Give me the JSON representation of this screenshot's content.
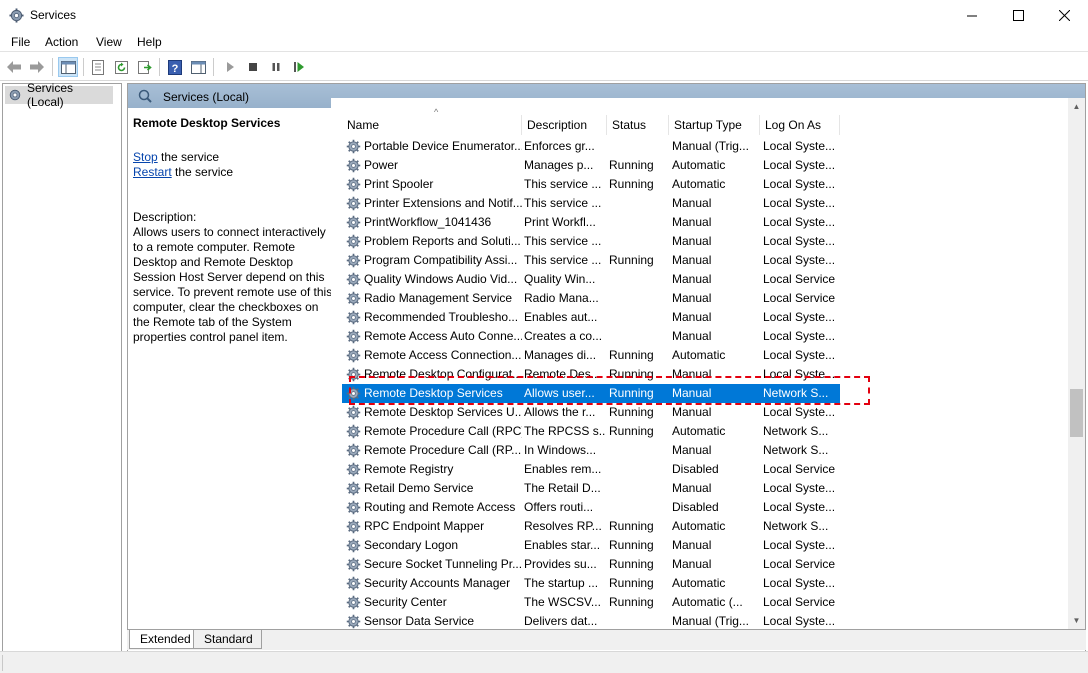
{
  "window": {
    "title": "Services"
  },
  "menu": [
    "File",
    "Action",
    "View",
    "Help"
  ],
  "tree": {
    "root_label": "Services (Local)"
  },
  "panel": {
    "header": "Services (Local)"
  },
  "details": {
    "service_title": "Remote Desktop Services",
    "stop_link": "Stop",
    "stop_suffix": " the service",
    "restart_link": "Restart",
    "restart_suffix": " the service",
    "description_label": "Description:",
    "description_text": "Allows users to connect interactively to a remote computer. Remote Desktop and Remote Desktop Session Host Server depend on this service. To prevent remote use of this computer, clear the checkboxes on the Remote tab of the System properties control panel item."
  },
  "columns": [
    "Name",
    "Description",
    "Status",
    "Startup Type",
    "Log On As"
  ],
  "services": [
    {
      "name": "Portable Device Enumerator...",
      "description": "Enforces gr...",
      "status": "",
      "startup": "Manual (Trig...",
      "logon": "Local Syste..."
    },
    {
      "name": "Power",
      "description": "Manages p...",
      "status": "Running",
      "startup": "Automatic",
      "logon": "Local Syste..."
    },
    {
      "name": "Print Spooler",
      "description": "This service ...",
      "status": "Running",
      "startup": "Automatic",
      "logon": "Local Syste..."
    },
    {
      "name": "Printer Extensions and Notif...",
      "description": "This service ...",
      "status": "",
      "startup": "Manual",
      "logon": "Local Syste..."
    },
    {
      "name": "PrintWorkflow_1041436",
      "description": "Print Workfl...",
      "status": "",
      "startup": "Manual",
      "logon": "Local Syste..."
    },
    {
      "name": "Problem Reports and Soluti...",
      "description": "This service ...",
      "status": "",
      "startup": "Manual",
      "logon": "Local Syste..."
    },
    {
      "name": "Program Compatibility Assi...",
      "description": "This service ...",
      "status": "Running",
      "startup": "Manual",
      "logon": "Local Syste..."
    },
    {
      "name": "Quality Windows Audio Vid...",
      "description": "Quality Win...",
      "status": "",
      "startup": "Manual",
      "logon": "Local Service"
    },
    {
      "name": "Radio Management Service",
      "description": "Radio Mana...",
      "status": "",
      "startup": "Manual",
      "logon": "Local Service"
    },
    {
      "name": "Recommended Troublesho...",
      "description": "Enables aut...",
      "status": "",
      "startup": "Manual",
      "logon": "Local Syste..."
    },
    {
      "name": "Remote Access Auto Conne...",
      "description": "Creates a co...",
      "status": "",
      "startup": "Manual",
      "logon": "Local Syste..."
    },
    {
      "name": "Remote Access Connection...",
      "description": "Manages di...",
      "status": "Running",
      "startup": "Automatic",
      "logon": "Local Syste..."
    },
    {
      "name": "Remote Desktop Configurat...",
      "description": "Remote Des...",
      "status": "Running",
      "startup": "Manual",
      "logon": "Local Syste..."
    },
    {
      "name": "Remote Desktop Services",
      "description": "Allows user...",
      "status": "Running",
      "startup": "Manual",
      "logon": "Network S...",
      "selected": true
    },
    {
      "name": "Remote Desktop Services U...",
      "description": "Allows the r...",
      "status": "Running",
      "startup": "Manual",
      "logon": "Local Syste..."
    },
    {
      "name": "Remote Procedure Call (RPC)",
      "description": "The RPCSS s...",
      "status": "Running",
      "startup": "Automatic",
      "logon": "Network S..."
    },
    {
      "name": "Remote Procedure Call (RP...",
      "description": "In Windows...",
      "status": "",
      "startup": "Manual",
      "logon": "Network S..."
    },
    {
      "name": "Remote Registry",
      "description": "Enables rem...",
      "status": "",
      "startup": "Disabled",
      "logon": "Local Service"
    },
    {
      "name": "Retail Demo Service",
      "description": "The Retail D...",
      "status": "",
      "startup": "Manual",
      "logon": "Local Syste..."
    },
    {
      "name": "Routing and Remote Access",
      "description": "Offers routi...",
      "status": "",
      "startup": "Disabled",
      "logon": "Local Syste..."
    },
    {
      "name": "RPC Endpoint Mapper",
      "description": "Resolves RP...",
      "status": "Running",
      "startup": "Automatic",
      "logon": "Network S..."
    },
    {
      "name": "Secondary Logon",
      "description": "Enables star...",
      "status": "Running",
      "startup": "Manual",
      "logon": "Local Syste..."
    },
    {
      "name": "Secure Socket Tunneling Pr...",
      "description": "Provides su...",
      "status": "Running",
      "startup": "Manual",
      "logon": "Local Service"
    },
    {
      "name": "Security Accounts Manager",
      "description": "The startup ...",
      "status": "Running",
      "startup": "Automatic",
      "logon": "Local Syste..."
    },
    {
      "name": "Security Center",
      "description": "The WSCSV...",
      "status": "Running",
      "startup": "Automatic (...",
      "logon": "Local Service"
    },
    {
      "name": "Sensor Data Service",
      "description": "Delivers dat...",
      "status": "",
      "startup": "Manual (Trig...",
      "logon": "Local Syste..."
    }
  ],
  "tabs": [
    "Extended",
    "Standard"
  ],
  "colors": {
    "selection": "#0078d7",
    "highlight": "#e3000f",
    "header": "#a8bfd6"
  }
}
